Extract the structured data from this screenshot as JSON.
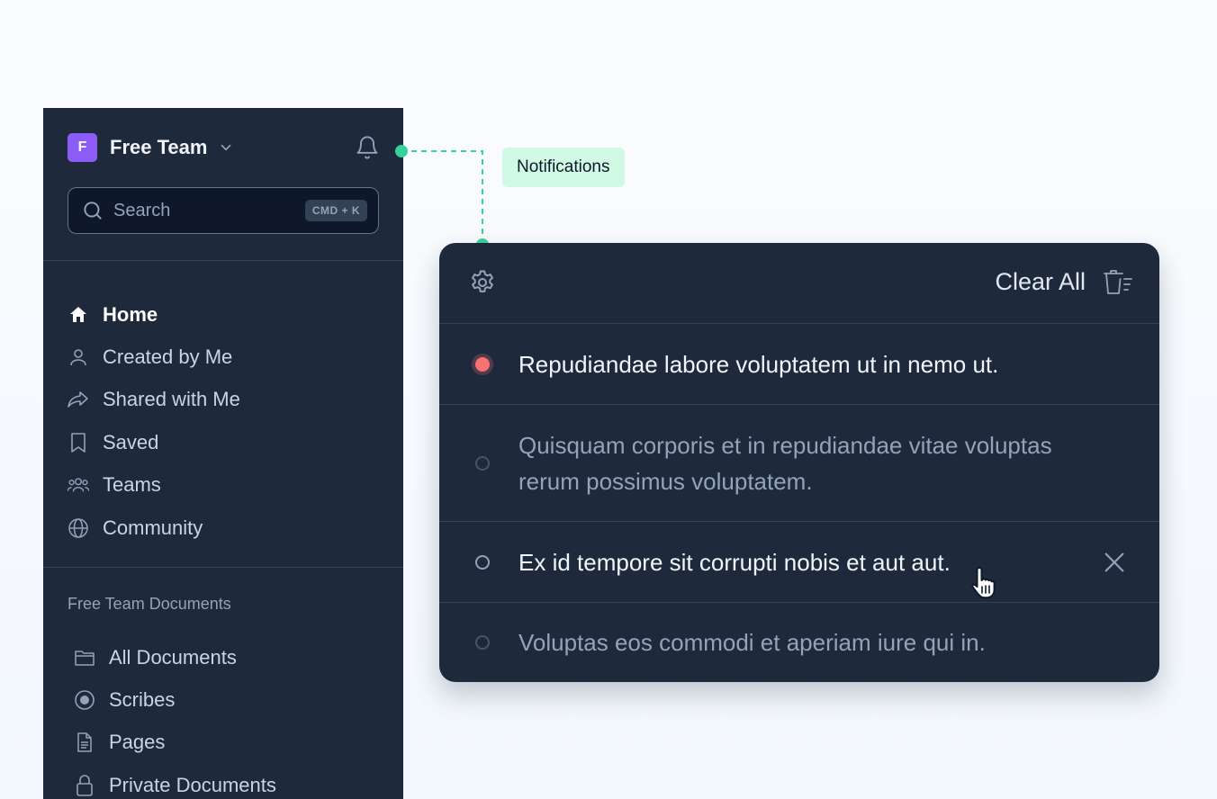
{
  "sidebar": {
    "team_initial": "F",
    "team_name": "Free Team",
    "search_placeholder": "Search",
    "search_shortcut": "CMD + K",
    "nav": [
      {
        "label": "Home",
        "icon": "home-icon",
        "active": true
      },
      {
        "label": "Created by Me",
        "icon": "user-icon"
      },
      {
        "label": "Shared with Me",
        "icon": "share-icon"
      },
      {
        "label": "Saved",
        "icon": "bookmark-icon"
      },
      {
        "label": "Teams",
        "icon": "users-icon"
      },
      {
        "label": "Community",
        "icon": "globe-icon"
      }
    ],
    "section_title": "Free Team Documents",
    "docs": [
      {
        "label": "All Documents",
        "icon": "folder-icon"
      },
      {
        "label": "Scribes",
        "icon": "record-icon"
      },
      {
        "label": "Pages",
        "icon": "page-icon"
      },
      {
        "label": "Private Documents",
        "icon": "lock-icon"
      }
    ]
  },
  "callout": "Notifications",
  "panel": {
    "clear_all": "Clear All",
    "notifications": [
      {
        "text": "Repudiandae labore voluptatem ut in nemo ut.",
        "state": "unread"
      },
      {
        "text": "Quisquam corporis et in repudiandae vitae voluptas rerum possimus voluptatem.",
        "state": "read"
      },
      {
        "text": "Ex id tempore sit corrupti nobis et aut aut.",
        "state": "hover"
      },
      {
        "text": "Voluptas eos commodi et aperiam iure qui in.",
        "state": "read"
      }
    ]
  },
  "colors": {
    "sidebar_bg": "#1e293b",
    "accent_purple": "#8b5cf6",
    "unread_red": "#f87171",
    "callout_green": "#d1fae5",
    "connector_green": "#34d399"
  }
}
